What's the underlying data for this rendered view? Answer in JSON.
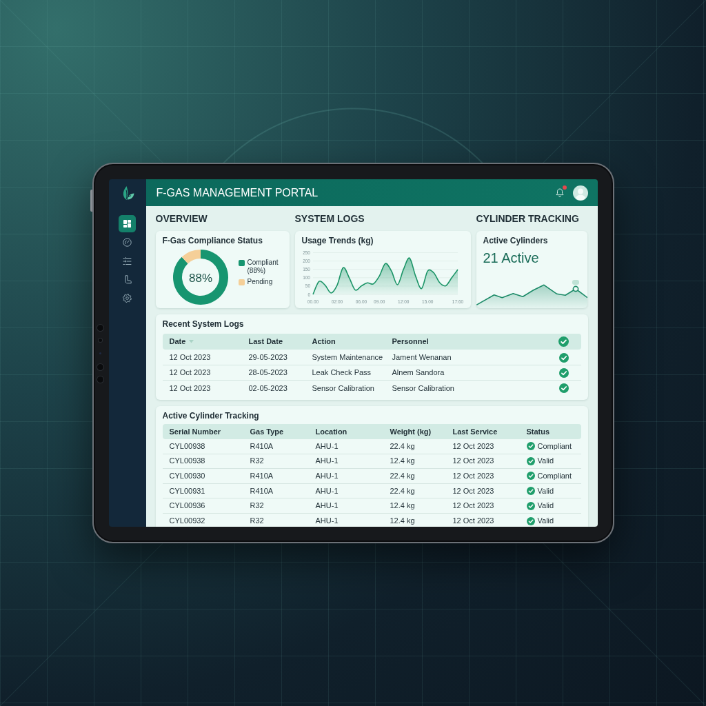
{
  "header": {
    "title": "F-GAS MANAGEMENT PORTAL",
    "has_notifications": true
  },
  "sidebar": {
    "items": [
      {
        "selected": true
      },
      {
        "selected": false
      },
      {
        "selected": false
      },
      {
        "selected": false
      },
      {
        "selected": false
      }
    ]
  },
  "overview": {
    "heading": "OVERVIEW",
    "card": {
      "title": "F-Gas Compliance Status",
      "center_label": "88%",
      "legend": [
        {
          "label": "Compliant (88%)",
          "color": "#179570"
        },
        {
          "label": "Pending",
          "color": "#f5cf98"
        }
      ],
      "chart_data": {
        "type": "donut",
        "values": [
          88,
          12
        ]
      }
    }
  },
  "system_logs": {
    "heading": "SYSTEM LOGS",
    "card": {
      "title": "Usage Trends (kg)",
      "chart_data": {
        "type": "area",
        "grid": true,
        "categories": [
          "00.00",
          null,
          null,
          null,
          "02:00",
          null,
          null,
          null,
          "06.00",
          null,
          null,
          "09.00",
          null,
          null,
          null,
          "12:00",
          null,
          null,
          null,
          "15.00",
          null,
          null,
          null,
          null,
          "17:60"
        ],
        "series": [
          {
            "color": "#1a9466",
            "values": [
              0,
              78,
              55,
              8,
              55,
              160,
              100,
              26,
              50,
              69,
              63,
              110,
              185,
              140,
              58,
              150,
              218,
              110,
              35,
              140,
              130,
              70,
              52,
              100,
              149
            ]
          }
        ],
        "ylim": [
          0,
          250
        ],
        "yticks": [
          0,
          50,
          100,
          150,
          200,
          250
        ]
      }
    }
  },
  "cylinder_tracking": {
    "heading": "CYLINDER TRACKING",
    "card": {
      "title": "Active Cylinders",
      "value": "21 Active"
    }
  },
  "recent_logs": {
    "title": "Recent System Logs",
    "columns": [
      {
        "label": "Date",
        "sorted": true
      },
      {
        "label": "Last Date",
        "sorted": false
      },
      {
        "label": "Action",
        "sorted": false
      },
      {
        "label": "Personnel",
        "sorted": false
      }
    ],
    "rows": [
      {
        "cells": [
          "12 Oct 2023",
          "29-05-2023",
          "System Maintenance",
          "Jament Wenanan"
        ],
        "verified": true
      },
      {
        "cells": [
          "12 Oct 2023",
          "28-05-2023",
          "Leak Check Pass",
          "Alnem Sandora"
        ],
        "verified": true
      },
      {
        "cells": [
          "12 Oct 2023",
          "02-05-2023",
          "Sensor Calibration",
          "Sensor Calibration"
        ],
        "verified": true
      }
    ]
  },
  "cylinders": {
    "title": "Active Cylinder Tracking",
    "columns": [
      "Serial Number",
      "Gas Type",
      "Location",
      "Weight (kg)",
      "Last Service",
      "Status"
    ],
    "rows": [
      {
        "cells": [
          "CYL00938",
          "R410A",
          "AHU-1",
          "22.4 kg",
          "12 Oct 2023"
        ],
        "status": "Compliant"
      },
      {
        "cells": [
          "CYL00938",
          "R32",
          "AHU-1",
          "12.4 kg",
          "12 Oct 2023"
        ],
        "status": "Valid"
      },
      {
        "cells": [
          "CYL00930",
          "R410A",
          "AHU-1",
          "22.4 kg",
          "12 Oct 2023"
        ],
        "status": "Compliant"
      },
      {
        "cells": [
          "CYL00931",
          "R410A",
          "AHU-1",
          "22.4 kg",
          "12 Oct 2023"
        ],
        "status": "Valid"
      },
      {
        "cells": [
          "CYL00936",
          "R32",
          "AHU-1",
          "12.4 kg",
          "12 Oct 2023"
        ],
        "status": "Valid"
      },
      {
        "cells": [
          "CYL00932",
          "R32",
          "AHU-1",
          "12.4 kg",
          "12 Oct 2023"
        ],
        "status": "Valid"
      }
    ]
  }
}
